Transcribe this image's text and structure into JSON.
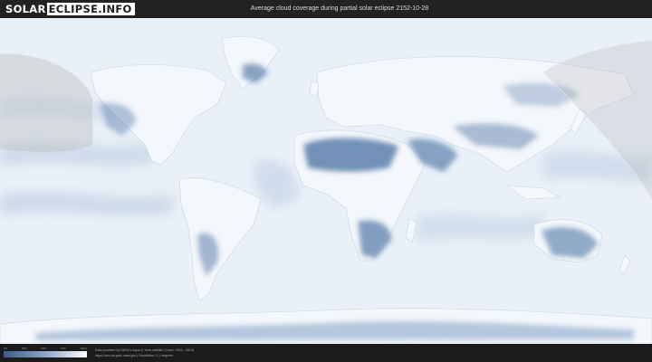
{
  "header": {
    "logo_part1": "SOLAR",
    "logo_part2": "ECLIPSE.INFO",
    "title": "Average cloud coverage during partial solar eclipse 2152-10-28"
  },
  "legend": {
    "ticks": [
      "0%",
      "25%",
      "50%",
      "75%",
      "100%"
    ],
    "gradient_colors": [
      "#3d5d87",
      "#8aa6c8",
      "#ffffff"
    ]
  },
  "footer": {
    "credit_line1": "Data provided by NASA's Aqua & Terra satellite (Years: 2003 - 2019)",
    "credit_line2": "https://neo.sci.gsfc.nasa.gov  |  Resolution: 0.1 degrees"
  },
  "map": {
    "ocean_color": "#e8eff8",
    "cloud_color": "#5b7fac",
    "eclipse_shade": "#b4b4b4"
  }
}
